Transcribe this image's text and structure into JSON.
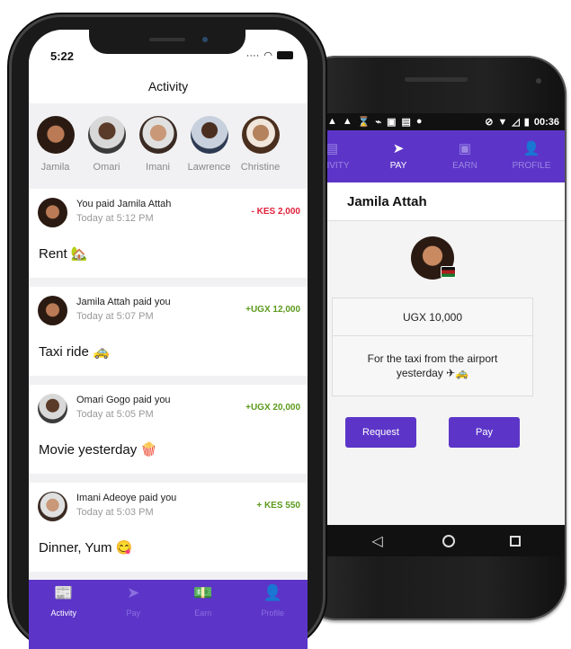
{
  "iphone": {
    "status_time": "5:22",
    "title": "Activity",
    "contacts": [
      {
        "name": "Jamila"
      },
      {
        "name": "Omari"
      },
      {
        "name": "Imani"
      },
      {
        "name": "Lawrence"
      },
      {
        "name": "Christine"
      }
    ],
    "feed": [
      {
        "who": "You paid Jamila Attah",
        "when": "Today at 5:12 PM",
        "amount": "- KES 2,000",
        "memo": "Rent 🏡"
      },
      {
        "who": "Jamila Attah paid you",
        "when": "Today at 5:07 PM",
        "amount": "+UGX 12,000",
        "memo": "Taxi ride 🚕"
      },
      {
        "who": "Omari Gogo paid you",
        "when": "Today at 5:05 PM",
        "amount": "+UGX 20,000",
        "memo": "Movie yesterday 🍿"
      },
      {
        "who": "Imani Adeoye paid you",
        "when": "Today at 5:03 PM",
        "amount": "+ KES 550",
        "memo": "Dinner, Yum 😋"
      }
    ],
    "tabs": [
      {
        "label": "Activity",
        "icon": "📰"
      },
      {
        "label": "Pay",
        "icon": "➤"
      },
      {
        "label": "Earn",
        "icon": "💵"
      },
      {
        "label": "Profile",
        "icon": "👤"
      }
    ]
  },
  "android": {
    "status_time": "00:36",
    "tabs": [
      {
        "label": "ACTIVITY",
        "icon": "▤"
      },
      {
        "label": "PAY",
        "icon": "➤"
      },
      {
        "label": "EARN",
        "icon": "▣"
      },
      {
        "label": "PROFILE",
        "icon": "👤"
      }
    ],
    "header_title": "Jamila Attah",
    "amount": "UGX 10,000",
    "note": "For the taxi from the airport yesterday ✈🚕",
    "request_label": "Request",
    "pay_label": "Pay"
  },
  "colors": {
    "accent": "#5c35c8",
    "negative": "#e0203a",
    "positive": "#5c9a1c"
  }
}
